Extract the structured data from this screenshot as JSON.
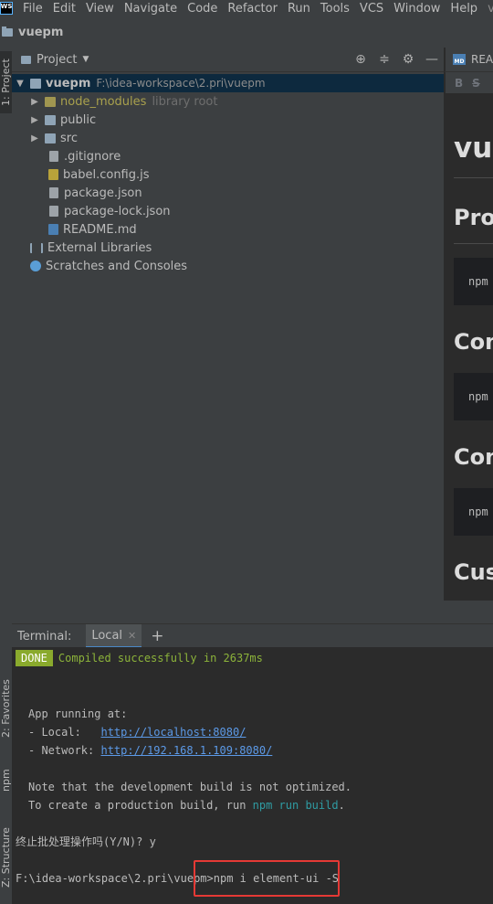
{
  "app": {
    "logo_text": "WS",
    "menu": [
      "File",
      "Edit",
      "View",
      "Navigate",
      "Code",
      "Refactor",
      "Run",
      "Tools",
      "VCS",
      "Window",
      "Help"
    ],
    "window_title_fragment": "vuep"
  },
  "navbar": {
    "project_name": "vuepm"
  },
  "left_tabs": {
    "project": "1: Project",
    "favorites": "2: Favorites",
    "npm": "npm",
    "structure": "Z: Structure"
  },
  "project_panel": {
    "title": "Project",
    "tree": {
      "root": {
        "name": "vuepm",
        "path": "F:\\idea-workspace\\2.pri\\vuepm"
      },
      "node_modules": {
        "name": "node_modules",
        "tag": "library root"
      },
      "public": "public",
      "src": "src",
      "gitignore": ".gitignore",
      "babel": "babel.config.js",
      "package": "package.json",
      "package_lock": "package-lock.json",
      "readme": "README.md",
      "external": "External Libraries",
      "scratches": "Scratches and Consoles"
    }
  },
  "editor": {
    "tab_label": "REA",
    "md_badge": "MD",
    "toolbar": [
      "B",
      "S"
    ],
    "preview": {
      "h1": "vue",
      "h2_1": "Pro",
      "code_1": "npm",
      "h2_2": "Com",
      "code_2": "npm",
      "h2_3": "Com",
      "code_3": "npm",
      "h2_4": "Cus"
    }
  },
  "terminal": {
    "title": "Terminal:",
    "tab": "Local",
    "done": "DONE",
    "compiled": "Compiled successfully in 2637ms",
    "app_running": "App running at:",
    "local_label": "- Local:   ",
    "local_url": "http://localhost:8080/",
    "network_label": "- Network: ",
    "network_url": "http://192.168.1.109:8080/",
    "note": "Note that the development build is not optimized.",
    "prod_prefix": "To create a production build, run ",
    "prod_cmd": "npm run build",
    "prod_suffix": ".",
    "terminate": "终止批处理操作吗(Y/N)? y",
    "prompt": "F:\\idea-workspace\\2.pri\\vuepm>",
    "command": "npm i element-ui -S"
  }
}
